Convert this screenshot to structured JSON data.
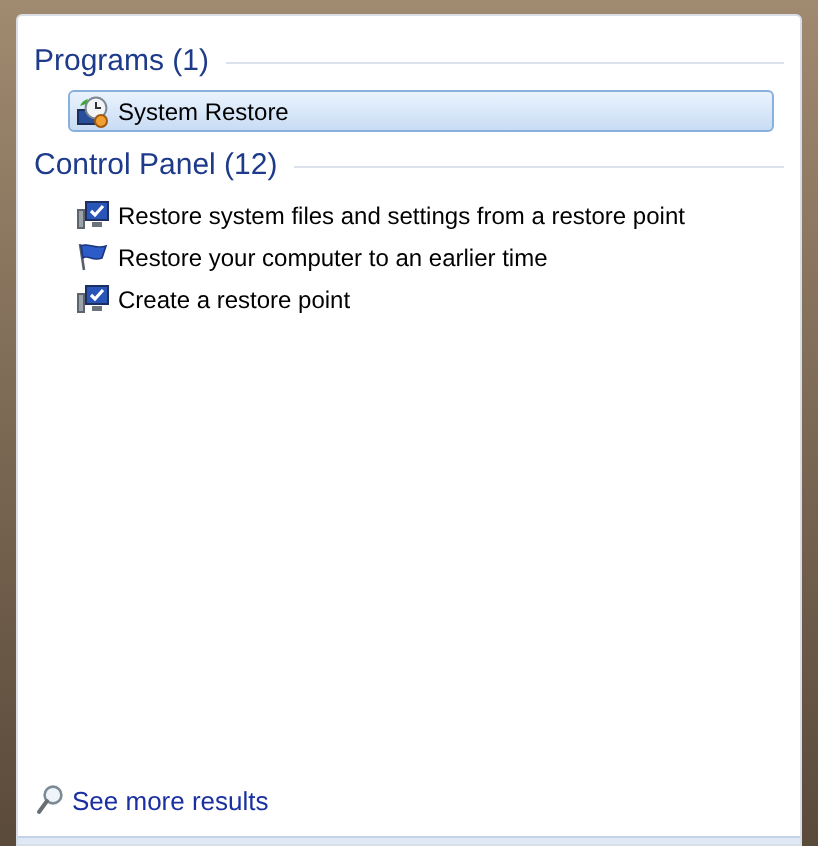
{
  "sections": [
    {
      "heading": "Programs (1)",
      "items": [
        {
          "label": "System Restore",
          "kind": "restore",
          "selected": true
        }
      ]
    },
    {
      "heading": "Control Panel (12)",
      "items": [
        {
          "label": "Restore system files and settings from a restore point",
          "kind": "monitor",
          "selected": false
        },
        {
          "label": "Restore your computer to an earlier time",
          "kind": "flag",
          "selected": false
        },
        {
          "label": "Create a restore point",
          "kind": "monitor",
          "selected": false
        }
      ]
    }
  ],
  "more_link": "See more results"
}
